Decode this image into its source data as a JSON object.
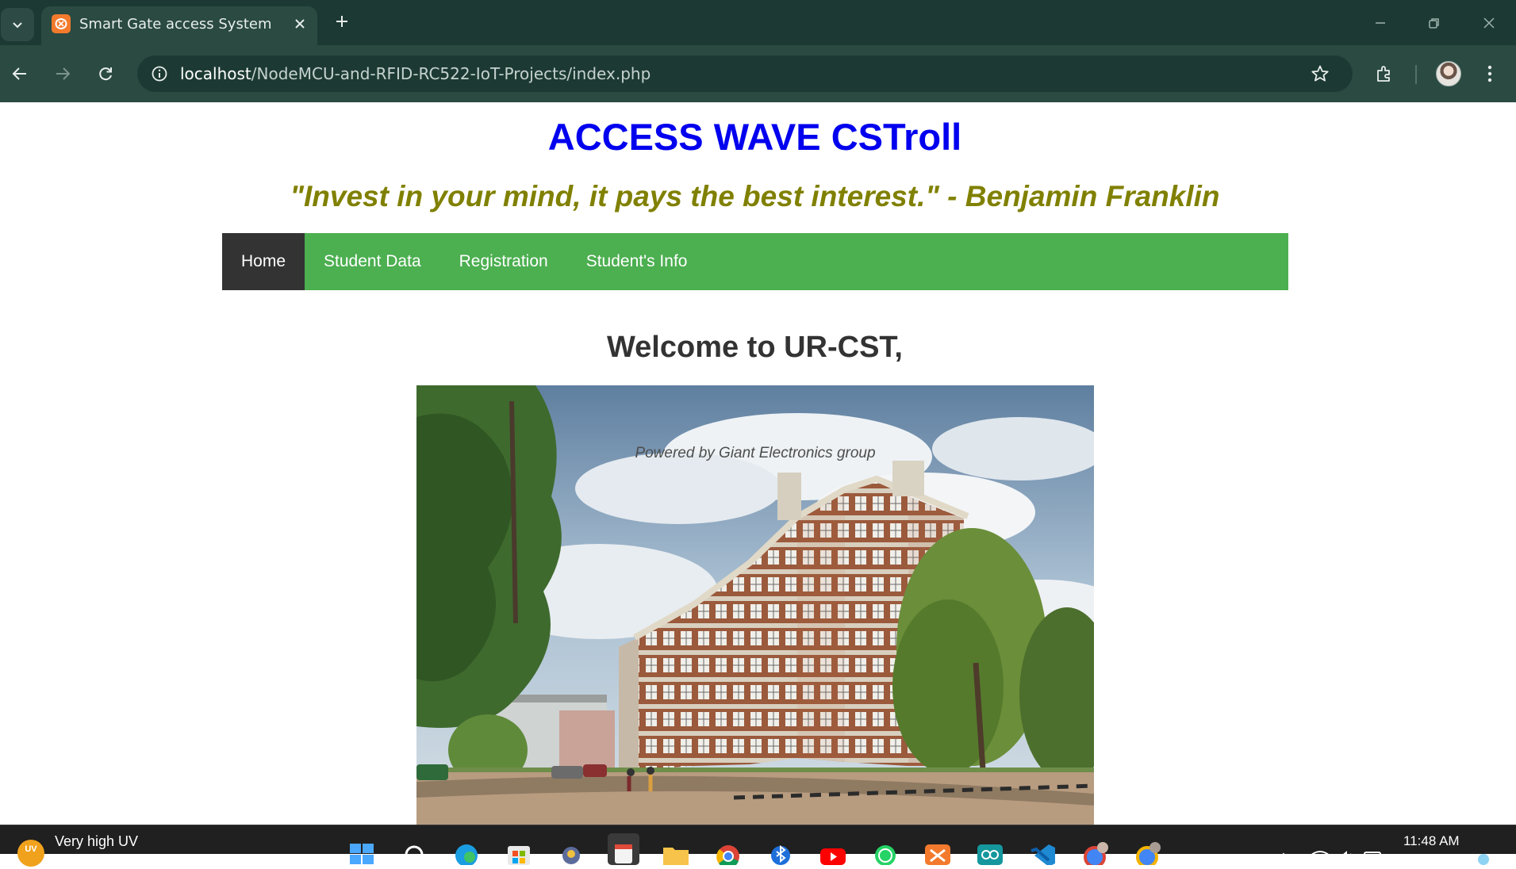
{
  "browser": {
    "tab_title": "Smart Gate access System",
    "url_host": "localhost",
    "url_path": "/NodeMCU-and-RFID-RC522-IoT-Projects/index.php",
    "icons": [
      "tab-list-icon",
      "xampp-favicon",
      "close-icon",
      "plus-icon",
      "minimize-icon",
      "restore-icon",
      "window-close-icon",
      "back-arrow-icon",
      "forward-arrow-icon",
      "reload-icon",
      "info-icon",
      "star-icon",
      "extensions-icon",
      "profile-avatar",
      "more-menu-icon"
    ]
  },
  "page": {
    "site_title": "ACCESS WAVE CSTroll",
    "quote": "\"Invest in your mind, it pays the best interest.\" - Benjamin Franklin",
    "nav": [
      {
        "label": "Home",
        "active": true
      },
      {
        "label": "Student Data",
        "active": false
      },
      {
        "label": "Registration",
        "active": false
      },
      {
        "label": "Student's Info",
        "active": false
      }
    ],
    "welcome": "Welcome to UR-CST,",
    "hero_caption": "Powered by Giant Electronics group"
  },
  "taskbar": {
    "weather_badge": "UV",
    "weather_text": "Very high UV",
    "time": "11:48 AM"
  },
  "colors": {
    "title_blue": "#0000ee",
    "quote_olive": "#808000",
    "nav_green": "#4caf50",
    "nav_active": "#333333",
    "chrome_dark": "#1c3a33",
    "chrome_toolbar": "#2a4a42"
  }
}
